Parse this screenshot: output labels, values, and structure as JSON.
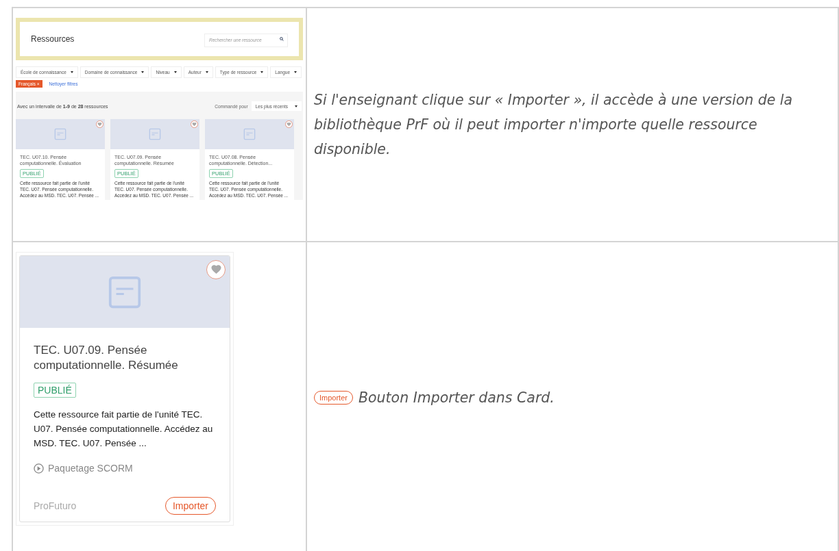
{
  "rows": [
    {
      "preview": {
        "title": "Ressources",
        "search": {
          "placeholder": "Rechercher une ressource"
        },
        "filters": [
          "École de connaissance",
          "Domaine de connaissance",
          "Niveau",
          "Auteur",
          "Type de ressource",
          "Langue"
        ],
        "chips": [
          {
            "label": "Français",
            "remove": "×"
          }
        ],
        "clear_link": "Nettoyer filtres",
        "count": "Avec un intervalle de **1-9** de **28** ressources",
        "sort_label": "Commandé pour",
        "sort_value": "Les plus récents",
        "cards": [
          {
            "title": "TEC. U07.10. Pensée computationnelle. Évaluation",
            "status": "PUBLIÉ",
            "description": "Cette ressource fait partie de l'unité TEC. U07. Pensée computationnelle. Accédez au MSD. TEC. U07. Pensée ..."
          },
          {
            "title": "TEC. U07.09. Pensée computationnelle. Résumée",
            "status": "PUBLIÉ",
            "description": "Cette ressource fait partie de l'unité TEC. U07. Pensée computationnelle. Accédez au MSD. TEC. U07. Pensée ..."
          },
          {
            "title": "TEC. U07.08. Pensée computationnelle. Détection...",
            "status": "PUBLIÉ",
            "description": "Cette ressource fait partie de l'unité TEC. U07. Pensée computationnelle. Accédez au MSD. TEC. U07. Pensée ..."
          }
        ]
      },
      "caption": "Si l'enseignant clique sur « Importer », il accède à une version de la bibliothèque PrF où il peut importer n'importe quelle ressource disponible."
    },
    {
      "card": {
        "title": "TEC. U07.09. Pensée computationnelle. Résumée",
        "status": "PUBLIÉ",
        "description": "Cette ressource fait partie de l'unité TEC. U07. Pensée computationnelle. Accédez au MSD. TEC. U07. Pensée ...",
        "type": "Paquetage SCORM",
        "provider": "ProFuturo",
        "button": "Importer"
      },
      "caption_button": "Importer",
      "caption": "Bouton Importer dans Card."
    }
  ]
}
